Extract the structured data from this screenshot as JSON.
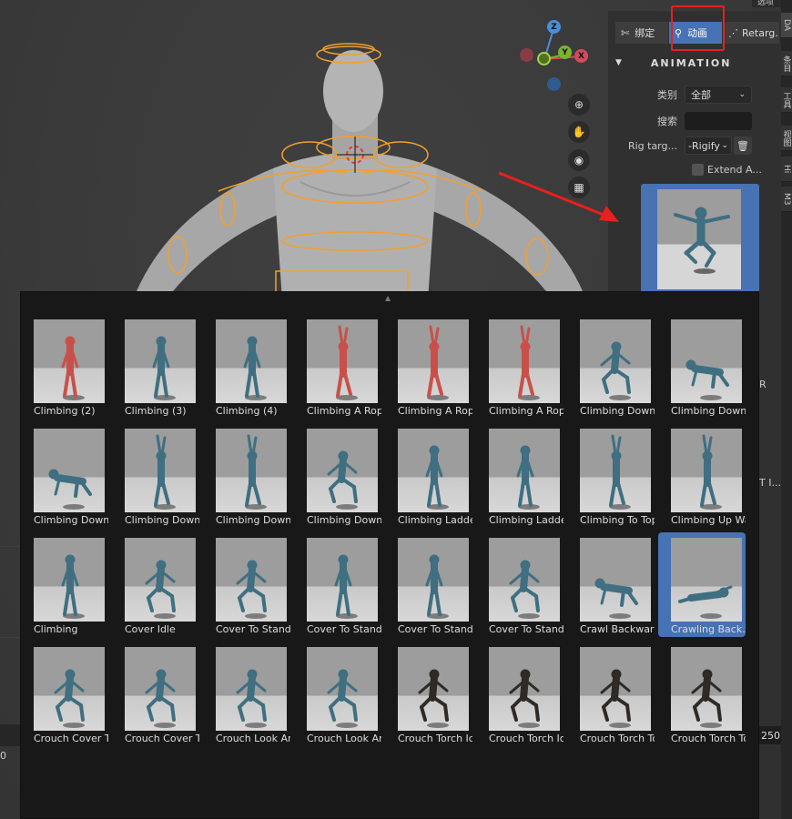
{
  "right_panel": {
    "tabs": [
      {
        "label": "绑定",
        "icon": "bone-icon"
      },
      {
        "label": "动画",
        "icon": "running-figure-icon"
      },
      {
        "label": "Retarg...",
        "icon": "retarget-icon"
      }
    ],
    "section_title": "ANIMATION",
    "category_label": "类别",
    "category_value": "全部",
    "search_label": "搜索",
    "search_value": "",
    "rig_target_label": "Rig targ...",
    "rig_target_value": "-Rigify",
    "extend_label": "Extend A...",
    "extend_checked": false,
    "peek_r": "R",
    "peek_t": "T I..."
  },
  "side_tabs": [
    "DA",
    "条目",
    "工具",
    "视图",
    "Hi",
    "M3"
  ],
  "top_right_text": "选项",
  "frame_end": "250",
  "frame_left": "0",
  "gizmo": {
    "x": "X",
    "y": "Y",
    "z": "Z"
  },
  "popup": {
    "items": [
      {
        "label": "Climbing (2)",
        "color": "red",
        "pose": "stand"
      },
      {
        "label": "Climbing (3)",
        "color": "teal",
        "pose": "stand"
      },
      {
        "label": "Climbing (4)",
        "color": "teal",
        "pose": "stand"
      },
      {
        "label": "Climbing A Rop...",
        "color": "red",
        "pose": "reach"
      },
      {
        "label": "Climbing A Rop...",
        "color": "red",
        "pose": "reach"
      },
      {
        "label": "Climbing A Rope",
        "color": "red",
        "pose": "reach"
      },
      {
        "label": "Climbing Down ...",
        "color": "teal",
        "pose": "crouch"
      },
      {
        "label": "Climbing Down ...",
        "color": "teal",
        "pose": "crawl"
      },
      {
        "label": "Climbing Down ...",
        "color": "teal",
        "pose": "crawl"
      },
      {
        "label": "Climbing Down ...",
        "color": "teal",
        "pose": "reach"
      },
      {
        "label": "Climbing Down ...",
        "color": "teal",
        "pose": "reach"
      },
      {
        "label": "Climbing Down",
        "color": "teal",
        "pose": "crouch"
      },
      {
        "label": "Climbing Ladde...",
        "color": "teal",
        "pose": "stand"
      },
      {
        "label": "Climbing Ladder",
        "color": "teal",
        "pose": "stand"
      },
      {
        "label": "Climbing To Top",
        "color": "teal",
        "pose": "reach"
      },
      {
        "label": "Climbing Up Wall",
        "color": "teal",
        "pose": "reach"
      },
      {
        "label": "Climbing",
        "color": "teal",
        "pose": "stand"
      },
      {
        "label": "Cover Idle",
        "color": "teal",
        "pose": "crouch"
      },
      {
        "label": "Cover To Stand ...",
        "color": "teal",
        "pose": "crouch"
      },
      {
        "label": "Cover To Stand ...",
        "color": "teal",
        "pose": "stand"
      },
      {
        "label": "Cover To Stand ...",
        "color": "teal",
        "pose": "stand"
      },
      {
        "label": "Cover To Stand",
        "color": "teal",
        "pose": "crouch"
      },
      {
        "label": "Crawl Backwards",
        "color": "teal",
        "pose": "crawl"
      },
      {
        "label": "Crawling Back...",
        "color": "teal",
        "pose": "lie",
        "selected": true
      },
      {
        "label": "Crouch Cover T...",
        "color": "teal",
        "pose": "crouch"
      },
      {
        "label": "Crouch Cover T...",
        "color": "teal",
        "pose": "crouch"
      },
      {
        "label": "Crouch Look Ar...",
        "color": "teal",
        "pose": "crouch"
      },
      {
        "label": "Crouch Look Ar...",
        "color": "teal",
        "pose": "crouch"
      },
      {
        "label": "Crouch Torch Idl...",
        "color": "dark",
        "pose": "crouch"
      },
      {
        "label": "Crouch Torch Idl...",
        "color": "dark",
        "pose": "crouch"
      },
      {
        "label": "Crouch Torch To...",
        "color": "dark",
        "pose": "crouch"
      },
      {
        "label": "Crouch Torch To...",
        "color": "dark",
        "pose": "crouch"
      }
    ]
  },
  "colors": {
    "accent": "#4772b3",
    "annotation": "#e8201e",
    "rig_orange": "#f0a030",
    "red_figure": "#c9504a",
    "teal_figure": "#3f6f80",
    "dark_figure": "#2e2a26"
  }
}
